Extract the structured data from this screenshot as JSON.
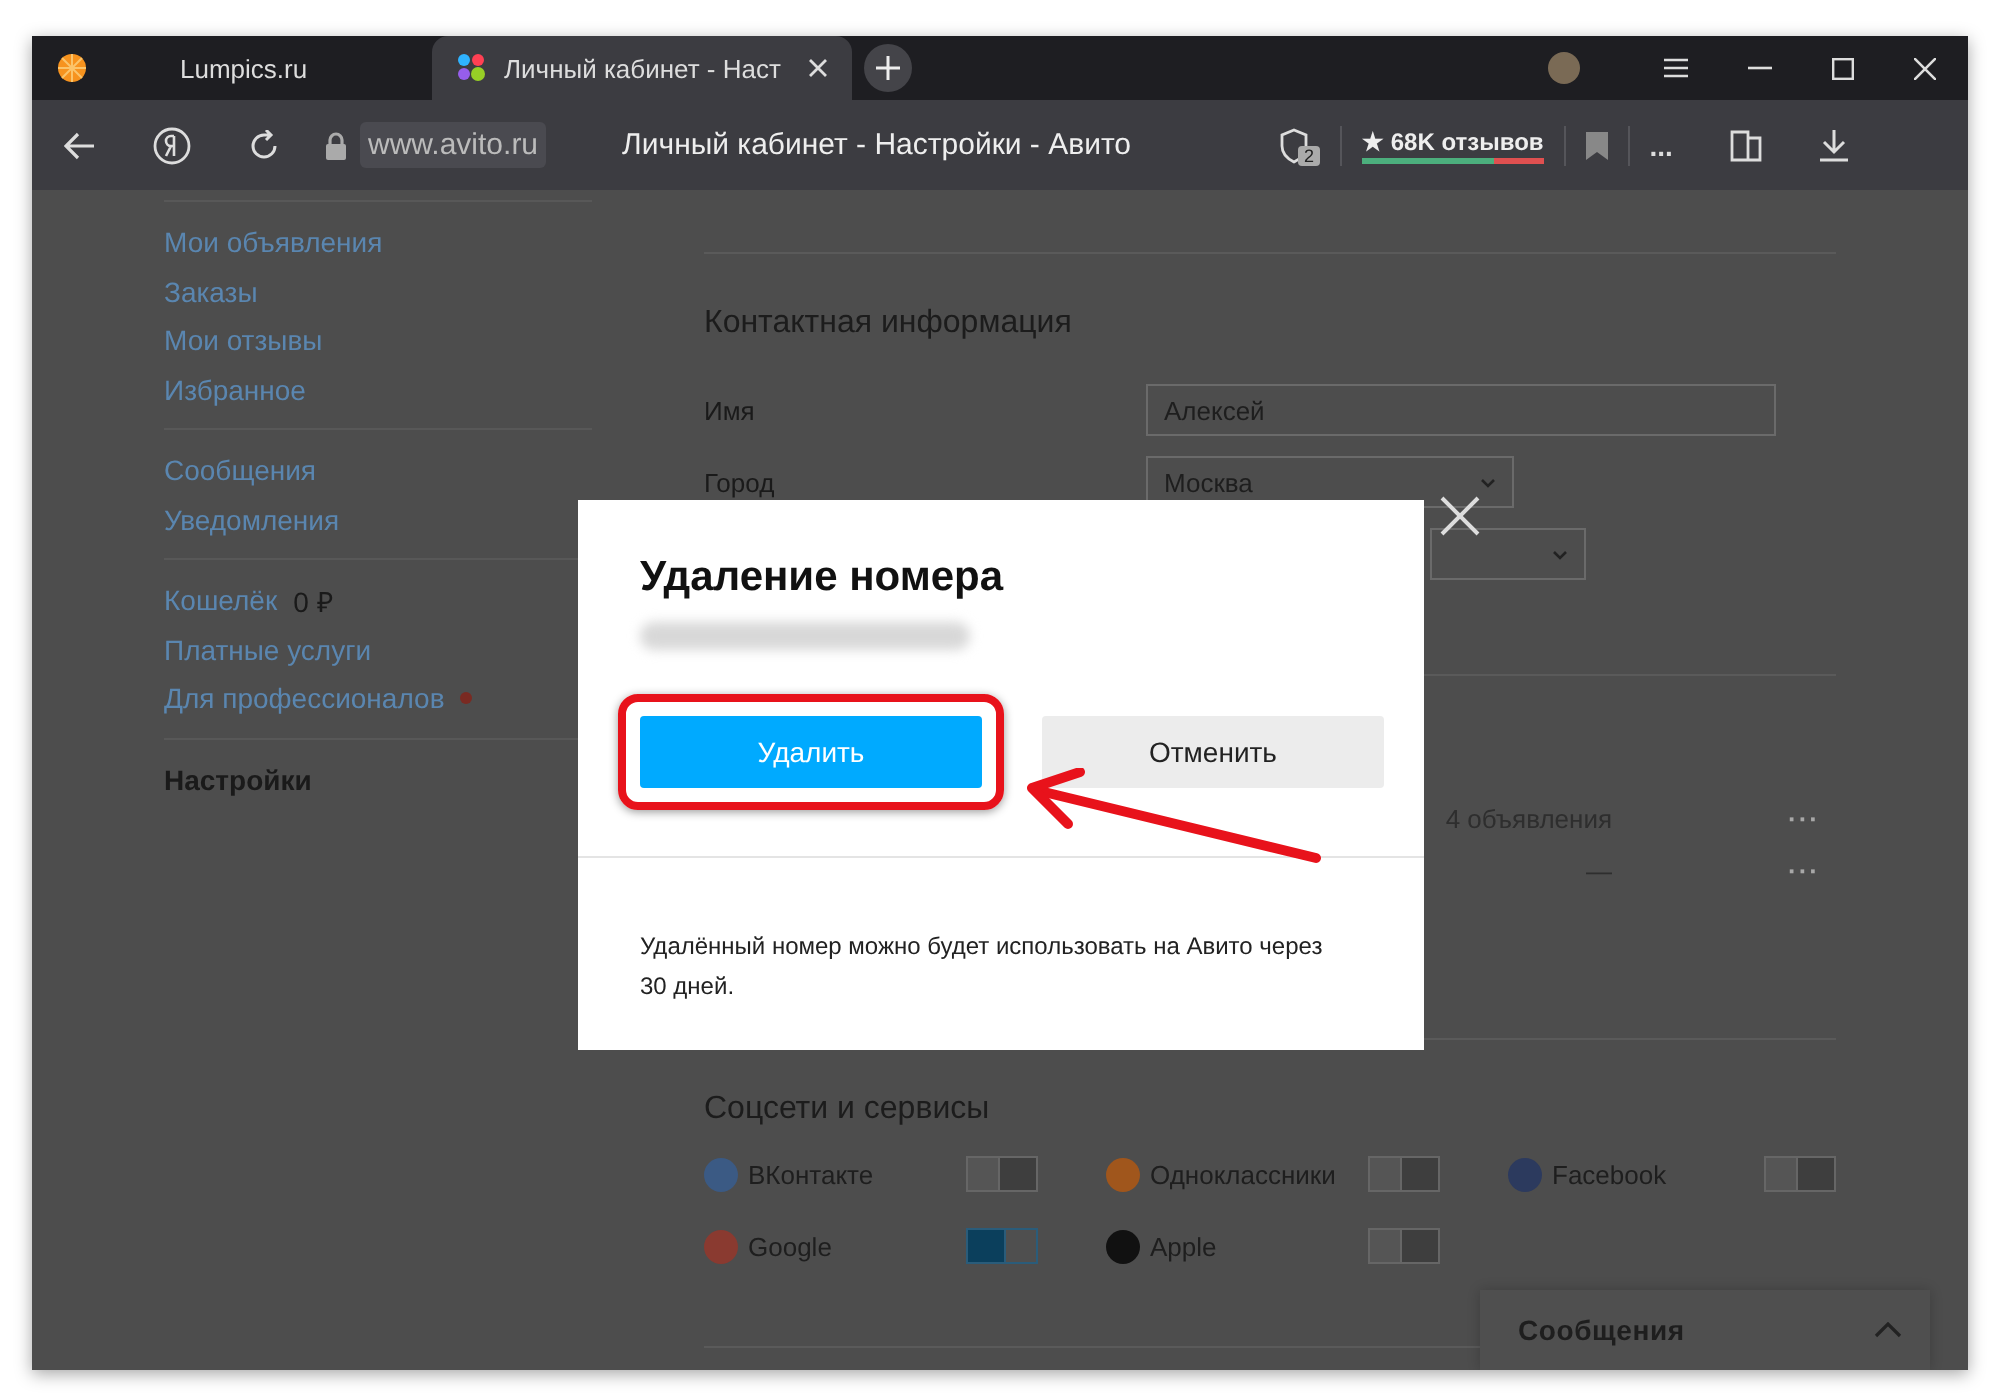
{
  "browser": {
    "tabs": [
      {
        "title": "Lumpics.ru",
        "selected": false
      },
      {
        "title": "Личный кабинет - Наст",
        "selected": true
      }
    ],
    "address": "www.avito.ru",
    "page_title": "Личный кабинет - Настройки - Авито",
    "shield_count": "2",
    "reviews": "★ 68K отзывов",
    "more": "..."
  },
  "sidebar": {
    "groups": [
      [
        {
          "label": "Мои объявления",
          "selected": false
        },
        {
          "label": "Заказы",
          "selected": false
        },
        {
          "label": "Мои отзывы",
          "selected": false
        },
        {
          "label": "Избранное",
          "selected": false
        }
      ],
      [
        {
          "label": "Сообщения",
          "selected": false
        },
        {
          "label": "Уведомления",
          "selected": false
        }
      ],
      [
        {
          "label": "Кошелёк",
          "amount": "0 ₽",
          "selected": false
        },
        {
          "label": "Платные услуги",
          "selected": false
        },
        {
          "label": "Для профессионалов",
          "dot": true,
          "selected": false
        }
      ],
      [
        {
          "label": "Настройки",
          "selected": true
        }
      ]
    ]
  },
  "contact": {
    "title": "Контактная информация",
    "fields": [
      {
        "label": "Имя",
        "value": "Алексей",
        "kind": "text"
      },
      {
        "label": "Город",
        "value": "Москва",
        "kind": "select"
      }
    ]
  },
  "phones": [
    {
      "count": "4 объявления",
      "more": "···"
    },
    {
      "count": "—",
      "more": "···"
    }
  ],
  "social": {
    "title": "Соцсети и сервисы",
    "items": [
      {
        "name": "ВКонтакте",
        "on": false
      },
      {
        "name": "Одноклассники",
        "on": false
      },
      {
        "name": "Facebook",
        "on": false
      },
      {
        "name": "Google",
        "on": true
      },
      {
        "name": "Apple",
        "on": false
      }
    ]
  },
  "messages_panel": {
    "title": "Сообщения",
    "expanded": false
  },
  "modal": {
    "title": "Удаление номера",
    "buttons": [
      {
        "label": "Удалить",
        "kind": "primary",
        "highlighted": true
      },
      {
        "label": "Отменить",
        "kind": "secondary",
        "highlighted": false
      }
    ],
    "note": "Удалённый номер можно будет использовать на Авито через 30 дней."
  }
}
